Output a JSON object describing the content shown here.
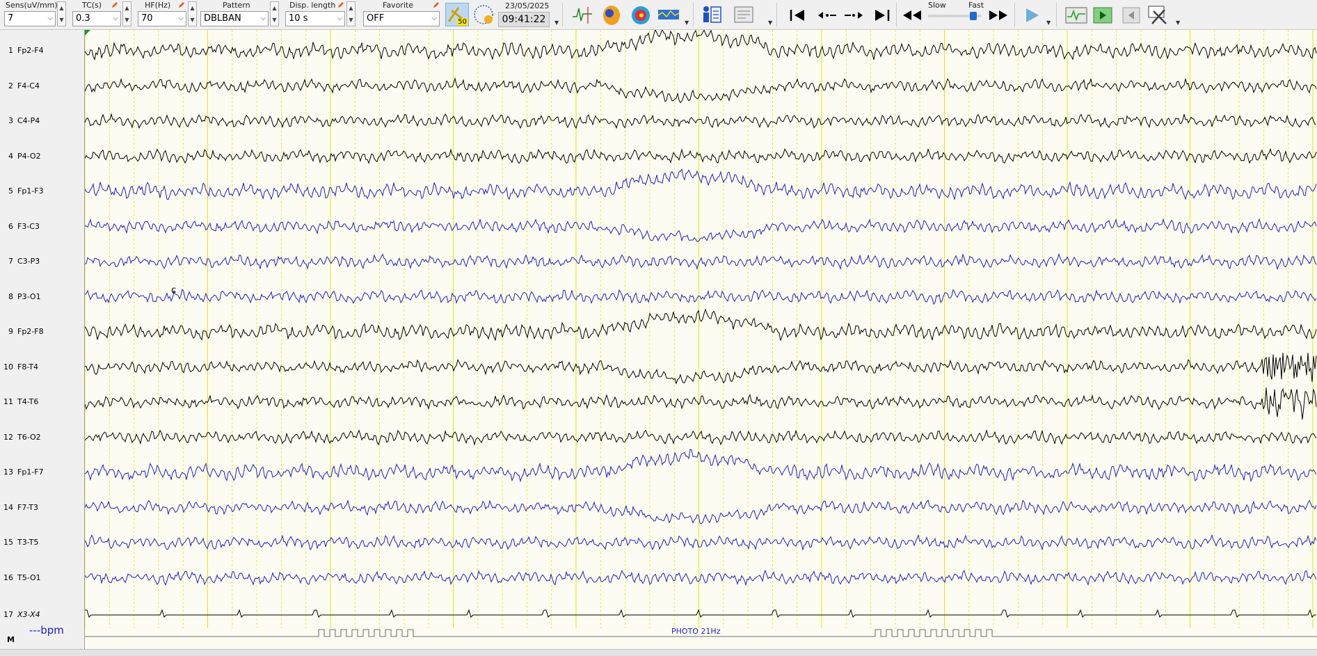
{
  "toolbar": {
    "sens": {
      "label": "Sens(uV/mm)",
      "value": "7"
    },
    "tc": {
      "label": "TC(s)",
      "value": "0.3"
    },
    "hf": {
      "label": "HF(Hz)",
      "value": "70"
    },
    "pattern": {
      "label": "Pattern",
      "value": "DBLBAN"
    },
    "disp_length": {
      "label": "Disp. length",
      "value": "10 s"
    },
    "favorite": {
      "label": "Favorite",
      "value": "OFF"
    },
    "badge": "50",
    "date": "23/05/2025",
    "time": "09:41:22",
    "speed_slow": "Slow",
    "speed_fast": "Fast"
  },
  "channels": [
    {
      "num": "1",
      "label": "Fp2-F4",
      "color": "#000000"
    },
    {
      "num": "2",
      "label": "F4-C4",
      "color": "#000000"
    },
    {
      "num": "3",
      "label": "C4-P4",
      "color": "#000000"
    },
    {
      "num": "4",
      "label": "P4-O2",
      "color": "#000000"
    },
    {
      "num": "5",
      "label": "Fp1-F3",
      "color": "#1e1ec8"
    },
    {
      "num": "6",
      "label": "F3-C3",
      "color": "#1e1ec8"
    },
    {
      "num": "7",
      "label": "C3-P3",
      "color": "#1e1ec8"
    },
    {
      "num": "8",
      "label": "P3-O1",
      "color": "#1e1ec8"
    },
    {
      "num": "9",
      "label": "Fp2-F8",
      "color": "#000000"
    },
    {
      "num": "10",
      "label": "F8-T4",
      "color": "#000000"
    },
    {
      "num": "11",
      "label": "T4-T6",
      "color": "#000000"
    },
    {
      "num": "12",
      "label": "T6-O2",
      "color": "#000000"
    },
    {
      "num": "13",
      "label": "Fp1-F7",
      "color": "#1e1ec8"
    },
    {
      "num": "14",
      "label": "F7-T3",
      "color": "#1e1ec8"
    },
    {
      "num": "15",
      "label": "T3-T5",
      "color": "#1e1ec8"
    },
    {
      "num": "16",
      "label": "T5-O1",
      "color": "#1e1ec8"
    },
    {
      "num": "17",
      "label": "X3-X4",
      "color": "#000000"
    }
  ],
  "bpm": "---bpm",
  "marker_row": "M",
  "photic_annotation": "PHOTO 21Hz",
  "colors": {
    "trace_bg": "#fdfcf2",
    "gridline": "#e6e600",
    "blue_trace": "#1e1ec8",
    "black_trace": "#000000",
    "annotation": "#1e1ec8"
  }
}
